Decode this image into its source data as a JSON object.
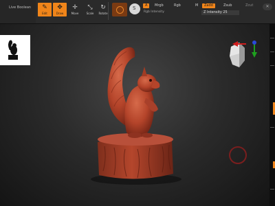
{
  "toolbar": {
    "lightbox_label": "Live Boolean",
    "tools": [
      {
        "name": "Edit",
        "icon": "✎",
        "active": true
      },
      {
        "name": "Draw",
        "icon": "✥",
        "active": true
      },
      {
        "name": "Move",
        "icon": "✛",
        "active": false
      },
      {
        "name": "Scale",
        "icon": "⤡",
        "active": false
      },
      {
        "name": "Rotate",
        "icon": "↻",
        "active": false
      }
    ],
    "mode_a": "A",
    "mrgb": "Mrgb",
    "rgb": "Rgb",
    "m": "M",
    "zadd": "Zadd",
    "zsub": "Zsub",
    "zcut": "Zcut",
    "rgb_intensity": "Rgb Intensity",
    "z_intensity": "Z Intensity 25"
  },
  "viewport": {
    "subject": "red clay squirrel on tree stump sculpt",
    "navigator_icon": "head-gizmo-icon"
  },
  "colors": {
    "accent": "#f0851a",
    "background": "#1d1d1d",
    "clay": "#b4442a"
  }
}
